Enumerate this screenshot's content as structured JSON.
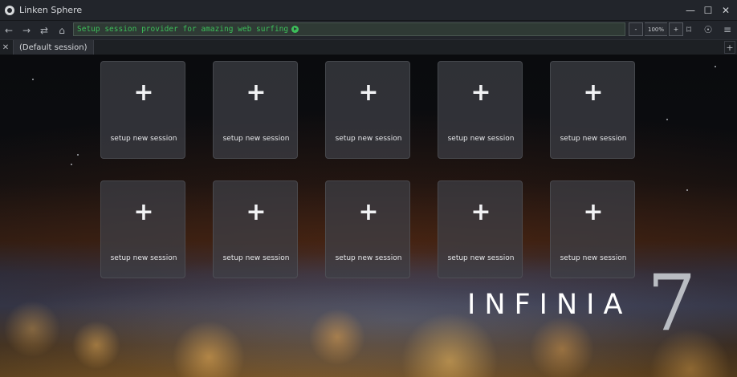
{
  "window": {
    "title": "Linken Sphere",
    "controls": {
      "minimize": "—",
      "maximize": "☐",
      "close": "✕"
    }
  },
  "navbar": {
    "back": "←",
    "forward": "→",
    "reload": "⇄",
    "home": "⌂",
    "address_text": "Setup session provider for amazing web surfing",
    "zoom_out": "-",
    "zoom_value": "100%",
    "zoom_in": "+",
    "bookmark": "⌑",
    "extension": "☉",
    "menu": "≡"
  },
  "tabs": {
    "close": "✕",
    "items": [
      {
        "label": "(Default session)"
      }
    ],
    "add": "+"
  },
  "sessions": {
    "plus": "+",
    "items": [
      {
        "label": "setup new session"
      },
      {
        "label": "setup new session"
      },
      {
        "label": "setup new session"
      },
      {
        "label": "setup new session"
      },
      {
        "label": "setup new session"
      },
      {
        "label": "setup new session"
      },
      {
        "label": "setup new session"
      },
      {
        "label": "setup new session"
      },
      {
        "label": "setup new session"
      },
      {
        "label": "setup new session"
      }
    ]
  },
  "branding": {
    "text": "INFINIA",
    "number": "7"
  },
  "colors": {
    "accent_green": "#3cbf5a",
    "chrome": "#22252b"
  }
}
